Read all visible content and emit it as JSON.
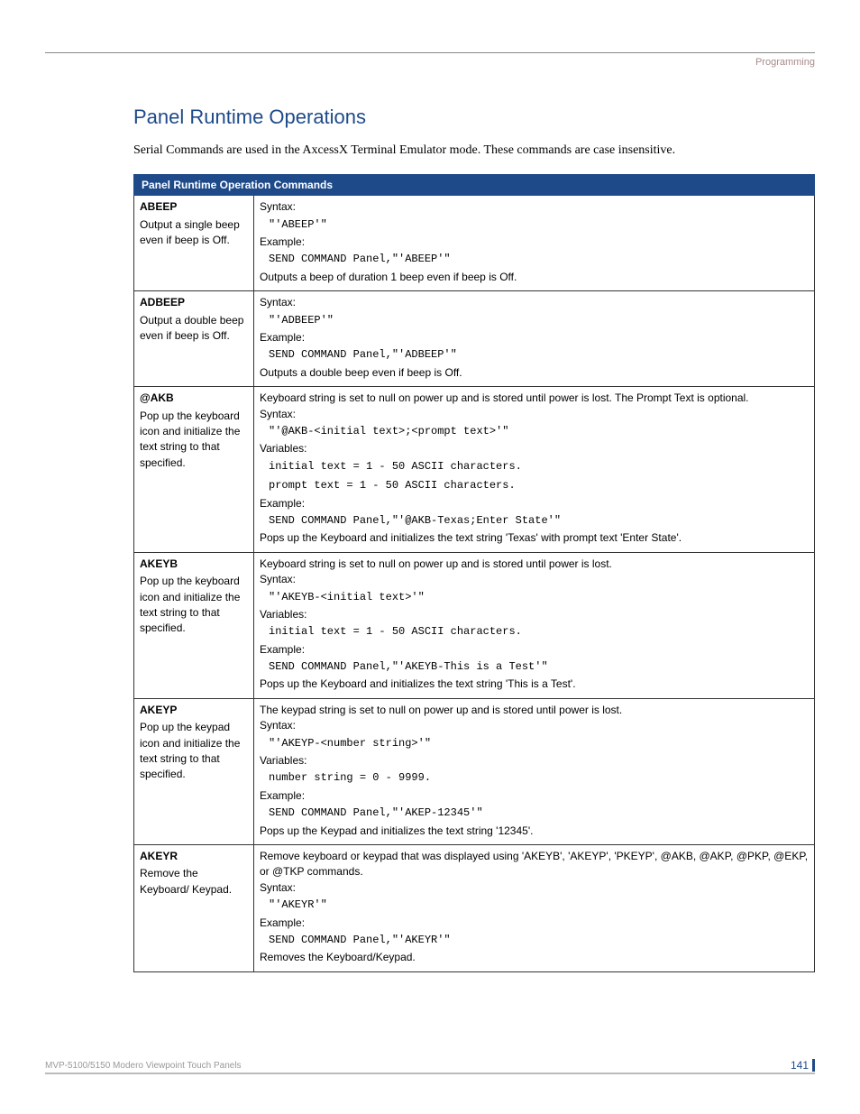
{
  "header": {
    "section_label": "Programming"
  },
  "title": "Panel Runtime Operations",
  "intro": "Serial Commands are used in the AxcessX Terminal Emulator mode. These commands are case insensitive.",
  "table_title": "Panel Runtime Operation Commands",
  "rows": [
    {
      "name": "ABEEP",
      "desc": "Output a single beep even if beep is Off.",
      "body": {
        "syntax_label": "Syntax:",
        "syntax_code": "\"'ABEEP'\"",
        "example_label": "Example:",
        "example_code": "SEND COMMAND Panel,\"'ABEEP'\"",
        "result": "Outputs a beep of duration 1 beep even if beep is Off."
      }
    },
    {
      "name": "ADBEEP",
      "desc": "Output a double beep even if beep is Off.",
      "body": {
        "syntax_label": "Syntax:",
        "syntax_code": "\"'ADBEEP'\"",
        "example_label": "Example:",
        "example_code": "SEND COMMAND Panel,\"'ADBEEP'\"",
        "result": "Outputs a double beep even if beep is Off."
      }
    },
    {
      "name": "@AKB",
      "desc": "Pop up the keyboard icon and initialize the text string to that specified.",
      "body": {
        "intro": "Keyboard string is set to null on power up and is stored until power is lost. The Prompt Text is optional.",
        "syntax_label": "Syntax:",
        "syntax_code": "\"'@AKB-<initial text>;<prompt text>'\"",
        "variables_label": "Variables:",
        "var1": "initial text = 1 - 50 ASCII characters.",
        "var2": "prompt text = 1 - 50 ASCII characters.",
        "example_label": "Example:",
        "example_code": "SEND COMMAND Panel,\"'@AKB-Texas;Enter State'\"",
        "result": "Pops up the Keyboard and initializes the text string 'Texas' with prompt text 'Enter State'."
      }
    },
    {
      "name": "AKEYB",
      "desc": "Pop up the keyboard icon and initialize the text string to that specified.",
      "body": {
        "intro": "Keyboard string is set to null on power up and is stored until power is lost.",
        "syntax_label": "Syntax:",
        "syntax_code": "\"'AKEYB-<initial text>'\"",
        "variables_label": "Variables:",
        "var1": "initial text = 1 - 50 ASCII characters.",
        "example_label": "Example:",
        "example_code": "SEND COMMAND Panel,\"'AKEYB-This is a Test'\"",
        "result": "Pops up the Keyboard and initializes the text string 'This is a Test'."
      }
    },
    {
      "name": "AKEYP",
      "desc": "Pop up the keypad icon and initialize the text string to that specified.",
      "body": {
        "intro": "The keypad string is set to null on power up and is stored until power is lost.",
        "syntax_label": "Syntax:",
        "syntax_code": "\"'AKEYP-<number string>'\"",
        "variables_label": "Variables:",
        "var1": "number string = 0 - 9999.",
        "example_label": "Example:",
        "example_code": "SEND COMMAND Panel,\"'AKEP-12345'\"",
        "result": "Pops up the Keypad and initializes the text string '12345'."
      }
    },
    {
      "name": "AKEYR",
      "desc": "Remove the Keyboard/ Keypad.",
      "body": {
        "intro": "Remove keyboard or keypad that was displayed using 'AKEYB', 'AKEYP', 'PKEYP', @AKB, @AKP, @PKP, @EKP, or @TKP commands.",
        "syntax_label": "Syntax:",
        "syntax_code": "\"'AKEYR'\"",
        "example_label": "Example:",
        "example_code": "SEND COMMAND Panel,\"'AKEYR'\"",
        "result": "Removes the Keyboard/Keypad."
      }
    }
  ],
  "footer": {
    "product": "MVP-5100/5150 Modero Viewpoint  Touch Panels",
    "page": "141"
  }
}
